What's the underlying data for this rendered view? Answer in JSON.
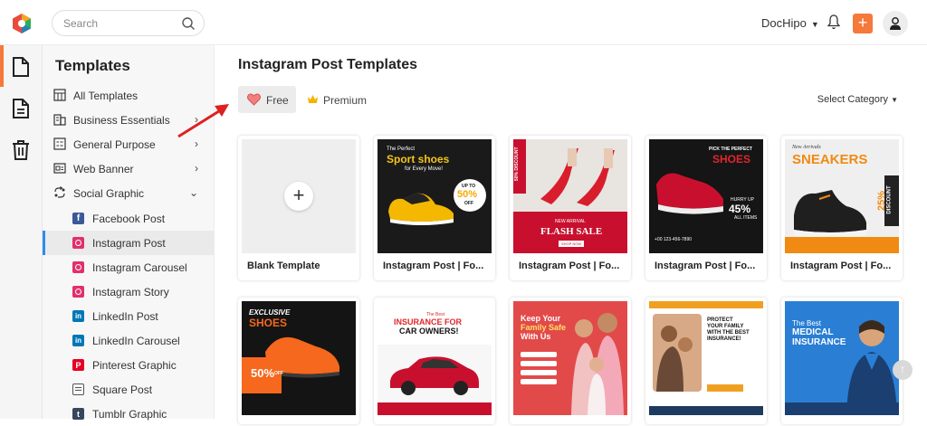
{
  "header": {
    "search_placeholder": "Search",
    "brand": "DocHipo",
    "add_label": "+"
  },
  "sidebar": {
    "title": "Templates",
    "items": [
      {
        "label": "All Templates",
        "icon": "grid-icon",
        "arrow": ""
      },
      {
        "label": "Business Essentials",
        "icon": "building-icon",
        "arrow": "›"
      },
      {
        "label": "General Purpose",
        "icon": "list-icon",
        "arrow": "›"
      },
      {
        "label": "Web Banner",
        "icon": "banner-icon",
        "arrow": "›"
      },
      {
        "label": "Social Graphic",
        "icon": "share-icon",
        "arrow": "⌄"
      }
    ],
    "subitems": [
      {
        "label": "Facebook Post",
        "icon": "facebook-icon",
        "color": "#3b5998"
      },
      {
        "label": "Instagram Post",
        "icon": "instagram-icon",
        "color": "#e1306c"
      },
      {
        "label": "Instagram Carousel",
        "icon": "instagram-icon",
        "color": "#e1306c"
      },
      {
        "label": "Instagram Story",
        "icon": "instagram-icon",
        "color": "#e1306c"
      },
      {
        "label": "LinkedIn Post",
        "icon": "linkedin-icon",
        "color": "#0077b5"
      },
      {
        "label": "LinkedIn Carousel",
        "icon": "linkedin-icon",
        "color": "#0077b5"
      },
      {
        "label": "Pinterest Graphic",
        "icon": "pinterest-icon",
        "color": "#e60023"
      },
      {
        "label": "Square Post",
        "icon": "square-icon",
        "color": "#555555"
      },
      {
        "label": "Tumblr Graphic",
        "icon": "tumblr-icon",
        "color": "#36465d"
      }
    ],
    "active_subitem": "Instagram Post"
  },
  "main": {
    "title": "Instagram Post Templates",
    "tab_free": "Free",
    "tab_premium": "Premium",
    "select_category": "Select Category",
    "cards_row1": [
      {
        "caption": "Blank Template"
      },
      {
        "caption": "Instagram Post | Fo...",
        "t1": "The Perfect",
        "t2": "Sport shoes",
        "t3": "for Every Move!",
        "t4": "UP TO",
        "t5": "50%",
        "t6": "OFF"
      },
      {
        "caption": "Instagram Post | Fo...",
        "t1": "50% DISCOUNT",
        "t2": "NEW ARRIVAL",
        "t3": "FLASH SALE",
        "t4": "SHOP NOW"
      },
      {
        "caption": "Instagram Post | Fo...",
        "t1": "PICK THE PERFECT",
        "t2": "SHOES",
        "t3": "HURRY UP",
        "t4": "45%",
        "t5": "ALL ITEMS",
        "t6": "+00 123-456-7890"
      },
      {
        "caption": "Instagram Post | Fo...",
        "t1": "New Arrivals",
        "t2": "SNEAKERS",
        "t3": "25%",
        "t4": "DISCOUNT"
      }
    ],
    "cards_row2": [
      {
        "t1": "EXCLUSIVE",
        "t2": "SHOES",
        "t3": "50%",
        "t4": "OFF"
      },
      {
        "t1": "The Best",
        "t2": "INSURANCE FOR",
        "t3": "CAR OWNERS!"
      },
      {
        "t1": "Keep Your",
        "t2": "Family Safe",
        "t3": "With Us"
      },
      {
        "t1": "PROTECT",
        "t2": "YOUR FAMILY",
        "t3": "WITH THE BEST",
        "t4": "INSURANCE!"
      },
      {
        "t1": "The Best",
        "t2": "MEDICAL",
        "t3": "INSURANCE"
      }
    ]
  },
  "colors": {
    "accent": "#f5793a",
    "active_bar": "#2d8cf0"
  }
}
